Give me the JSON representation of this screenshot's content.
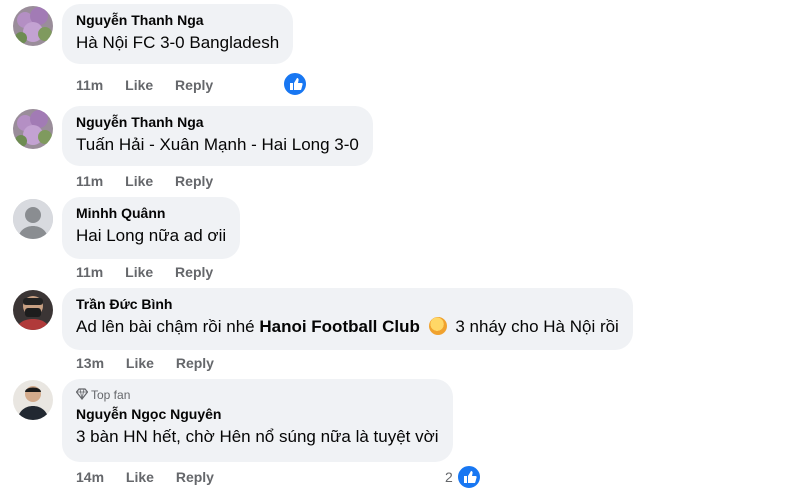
{
  "comments": [
    {
      "author": "Nguyễn Thanh Nga",
      "text": "Hà Nội FC 3-0 Bangladesh",
      "time": "11m",
      "like": "Like",
      "reply": "Reply",
      "reaction_icon": "like-reaction-icon"
    },
    {
      "author": "Nguyễn Thanh Nga",
      "text": "Tuấn Hải - Xuân Mạnh - Hai Long 3-0",
      "time": "11m",
      "like": "Like",
      "reply": "Reply"
    },
    {
      "author": "Minhh Quânn",
      "text": "Hai Long nữa ad ơii",
      "time": "11m",
      "like": "Like",
      "reply": "Reply"
    },
    {
      "author": "Trần Đức Bình",
      "text_before": "Ad lên bài chậm rồi nhé",
      "tag": "Hanoi Football Club",
      "emoji": "grinning-sweat-emoji",
      "text_after": "3 nháy cho Hà Nội rồi",
      "time": "13m",
      "like": "Like",
      "reply": "Reply"
    },
    {
      "badge": "Top fan",
      "author": "Nguyễn Ngọc Nguyên",
      "text": "3 bàn HN hết, chờ Hên nổ súng nữa là tuyệt vời",
      "time": "14m",
      "like": "Like",
      "reply": "Reply",
      "reaction_count": "2",
      "reaction_icon": "like-reaction-icon"
    }
  ],
  "colors": {
    "bubble": "#f0f2f5",
    "like_blue": "#1877f2",
    "meta": "#65676b"
  }
}
